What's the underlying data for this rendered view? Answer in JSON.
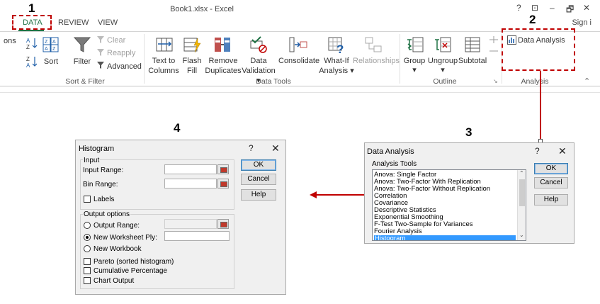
{
  "window": {
    "title": "Book1.xlsx - Excel",
    "help": "?",
    "ribbon_options": "⊡",
    "minimize": "–",
    "restore": "🗗",
    "close": "✕",
    "sign_in": "Sign i"
  },
  "tabs": {
    "data": "DATA",
    "review": "REVIEW",
    "view": "VIEW"
  },
  "ribbon": {
    "cut_left": "ons",
    "sort_filter": {
      "sort_az": "A↓Z",
      "sort_za": "Z↓A",
      "sort": "Sort",
      "filter": "Filter",
      "clear": "Clear",
      "reapply": "Reapply",
      "advanced": "Advanced",
      "group_label": "Sort & Filter"
    },
    "data_tools": {
      "text_to_columns_1": "Text to",
      "text_to_columns_2": "Columns",
      "flash_fill_1": "Flash",
      "flash_fill_2": "Fill",
      "remove_duplicates_1": "Remove",
      "remove_duplicates_2": "Duplicates",
      "data_validation_1": "Data",
      "data_validation_2": "Validation ▾",
      "consolidate": "Consolidate",
      "what_if_1": "What-If",
      "what_if_2": "Analysis ▾",
      "relationships": "Relationships",
      "group_label": "Data Tools"
    },
    "outline": {
      "group": "Group",
      "ungroup": "Ungroup",
      "subtotal": "Subtotal",
      "group_label": "Outline"
    },
    "analysis": {
      "data_analysis": "Data Analysis",
      "group_label": "Analysis"
    }
  },
  "annotations": {
    "n1": "1",
    "n2": "2",
    "n3": "3",
    "n4": "4"
  },
  "colors": {
    "accent_green": "#217346",
    "annotation_red": "#c00000",
    "selection_blue": "#3399ff"
  },
  "data_analysis_dialog": {
    "title": "Data Analysis",
    "help": "?",
    "close": "✕",
    "tools_label": "Analysis Tools",
    "items": [
      "Anova: Single Factor",
      "Anova: Two-Factor With Replication",
      "Anova: Two-Factor Without Replication",
      "Correlation",
      "Covariance",
      "Descriptive Statistics",
      "Exponential Smoothing",
      "F-Test Two-Sample for Variances",
      "Fourier Analysis",
      "Histogram"
    ],
    "selected": "Histogram",
    "ok": "OK",
    "cancel": "Cancel",
    "help_btn": "Help"
  },
  "histogram_dialog": {
    "title": "Histogram",
    "help": "?",
    "close": "✕",
    "input_group": "Input",
    "input_range": "Input Range:",
    "bin_range": "Bin Range:",
    "labels": "Labels",
    "output_group": "Output options",
    "output_range": "Output Range:",
    "new_worksheet_ply": "New Worksheet Ply:",
    "new_workbook": "New Workbook",
    "pareto": "Pareto (sorted histogram)",
    "cumulative": "Cumulative Percentage",
    "chart_output": "Chart Output",
    "ok": "OK",
    "cancel": "Cancel",
    "help_btn": "Help"
  }
}
